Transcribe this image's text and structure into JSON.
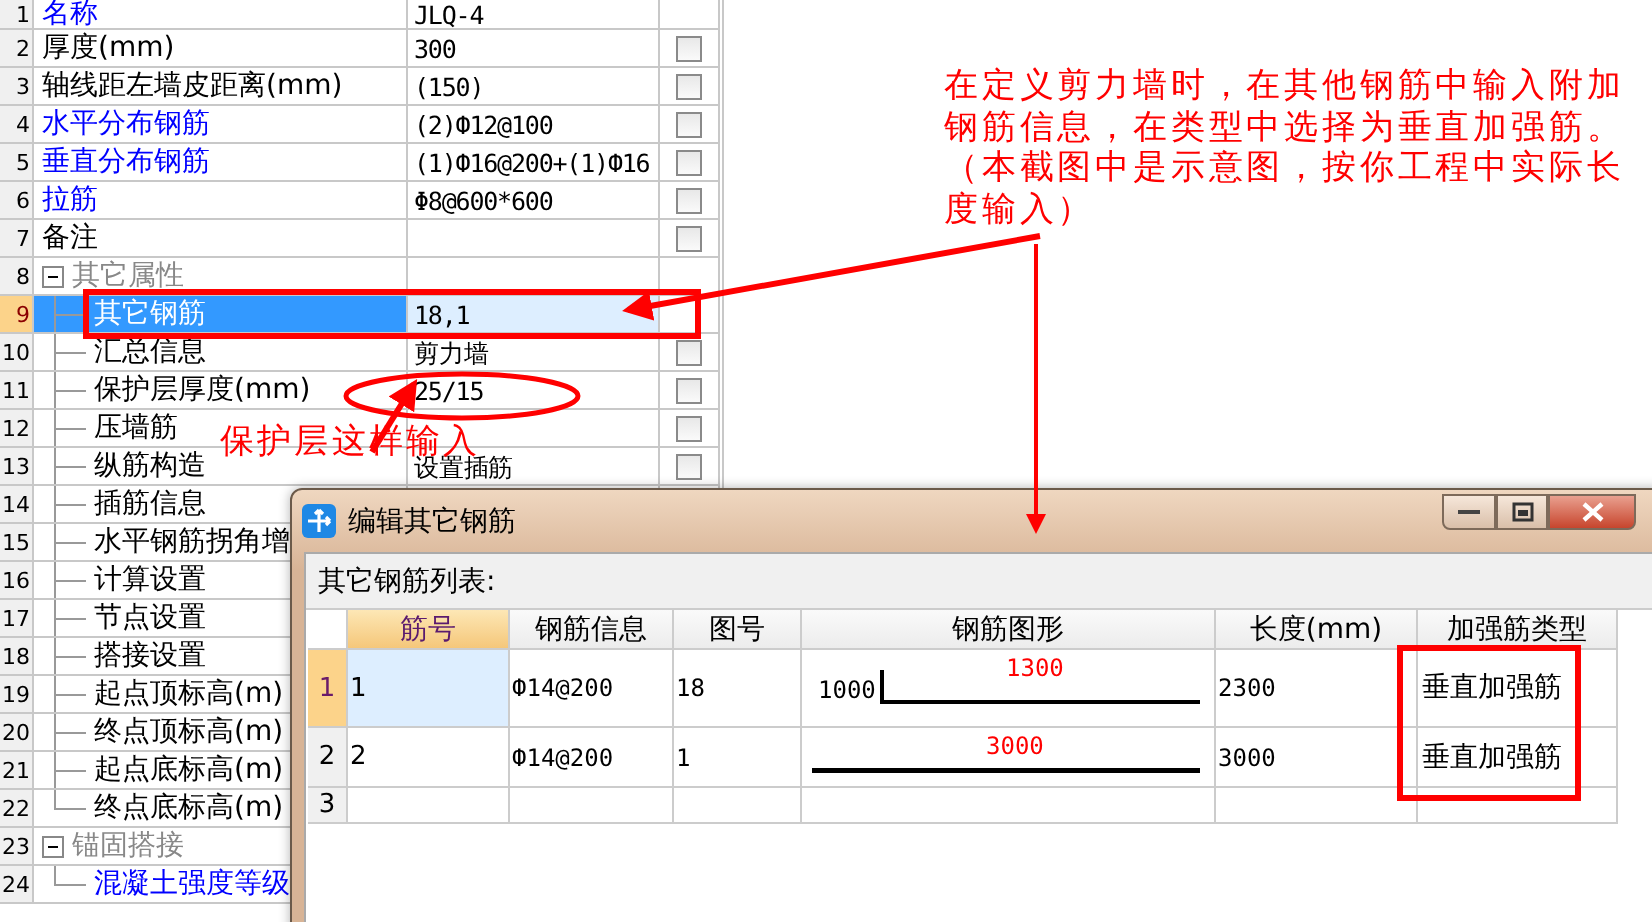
{
  "properties": [
    {
      "number": "1",
      "name": "名称",
      "value": "JLQ-4",
      "emphasis": true,
      "selected": false
    },
    {
      "number": "2",
      "name": "厚度(mm)",
      "value": "300",
      "emphasis": false,
      "selected": false,
      "checked": false
    },
    {
      "number": "3",
      "name": "轴线距左墙皮距离(mm)",
      "value": "(150)",
      "emphasis": false,
      "selected": false,
      "checked": false
    },
    {
      "number": "4",
      "name": "水平分布钢筋",
      "value": "(2)Ф12@100",
      "emphasis": true,
      "selected": false,
      "checked": false
    },
    {
      "number": "5",
      "name": "垂直分布钢筋",
      "value": "(1)Ф16@200+(1)Ф16",
      "emphasis": true,
      "selected": false,
      "checked": false
    },
    {
      "number": "6",
      "name": "拉筋",
      "value": "Φ8@600*600",
      "emphasis": true,
      "selected": false,
      "checked": false
    },
    {
      "number": "7",
      "name": "备注",
      "emphasis": false,
      "selected": false,
      "checked": false
    },
    {
      "number": "8",
      "name": "其它属性",
      "kind": "group",
      "expanded": true,
      "selected": false,
      "children": [
        {
          "number": "9",
          "name": "其它钢筋",
          "value": "18,1",
          "emphasis": false,
          "selected": true
        },
        {
          "number": "10",
          "name": "汇总信息",
          "value": "剪力墙",
          "emphasis": false,
          "selected": false,
          "checked": false
        },
        {
          "number": "11",
          "name": "保护层厚度(mm)",
          "value": "25/15",
          "emphasis": false,
          "selected": false,
          "checked": false
        },
        {
          "number": "12",
          "name": "压墙筋",
          "emphasis": false,
          "selected": false,
          "checked": false
        },
        {
          "number": "13",
          "name": "纵筋构造",
          "value": "设置插筋",
          "emphasis": false,
          "selected": false,
          "checked": false
        },
        {
          "number": "14",
          "name": "插筋信息",
          "emphasis": false,
          "selected": false
        },
        {
          "number": "15",
          "name": "水平钢筋拐角增",
          "emphasis": false,
          "selected": false
        },
        {
          "number": "16",
          "name": "计算设置",
          "emphasis": false,
          "selected": false
        },
        {
          "number": "17",
          "name": "节点设置",
          "emphasis": false,
          "selected": false
        },
        {
          "number": "18",
          "name": "搭接设置",
          "emphasis": false,
          "selected": false
        },
        {
          "number": "19",
          "name": "起点顶标高(m)",
          "emphasis": false,
          "selected": false
        },
        {
          "number": "20",
          "name": "终点顶标高(m)",
          "emphasis": false,
          "selected": false
        },
        {
          "number": "21",
          "name": "起点底标高(m)",
          "emphasis": false,
          "selected": false
        },
        {
          "number": "22",
          "name": "终点底标高(m)",
          "emphasis": false,
          "selected": false
        }
      ]
    },
    {
      "number": "23",
      "name": "锚固搭接",
      "kind": "group",
      "expanded": true,
      "selected": false,
      "children": [
        {
          "number": "24",
          "name": "混凝土强度等级",
          "emphasis": true,
          "selected": false
        }
      ]
    }
  ],
  "dialog": {
    "title": "编辑其它钢筋",
    "list_label": "其它钢筋列表:",
    "columns": [
      "筋号",
      "钢筋信息",
      "图号",
      "钢筋图形",
      "长度(mm)",
      "加强筋类型"
    ],
    "rows": [
      {
        "number": "1",
        "bar_no": "1",
        "info": "Ф14@200",
        "figure_no": "18",
        "shape": {
          "kind": "bent",
          "side": "1000",
          "span": "1300"
        },
        "length": "2300",
        "type": "垂直加强筋",
        "selected": true
      },
      {
        "number": "2",
        "bar_no": "2",
        "info": "Ф14@200",
        "figure_no": "1",
        "shape": {
          "kind": "straight",
          "span": "3000"
        },
        "length": "3000",
        "type": "垂直加强筋",
        "selected": false
      },
      {
        "number": "3",
        "selected": false
      }
    ]
  },
  "annotations": {
    "note": "在定义剪力墙时，在其他钢筋中输入附加钢筋信息，在类型中选择为垂直加强筋。（本截图中是示意图，按你工程中实际长度输入）",
    "label": "保护层这样输入"
  }
}
